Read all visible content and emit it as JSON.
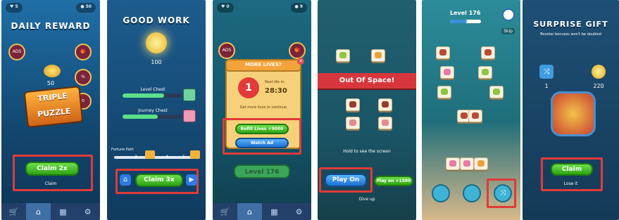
{
  "panels": [
    {
      "title": "DAILY REWARD",
      "coin_count": "50",
      "game_logo": "TRIPLE PUZZLE",
      "claim_button": "Claim 2x",
      "claim_label": "Claim",
      "side_icons_left": [
        "ADS"
      ],
      "nav": [
        "cart-icon",
        "home-icon",
        "grid-icon",
        "gear-icon"
      ]
    },
    {
      "title": "GOOD WORK",
      "coin_count": "100",
      "level_chest": "Level Chest",
      "journey_chest": "Journey Chest",
      "fortune_label": "Fortune Path",
      "path_steps": [
        "2",
        "4",
        "5"
      ],
      "claim_button": "Claim 3x"
    },
    {
      "title": "MORE LIVES?",
      "next_life_label": "Next life in:",
      "timer": "28:30",
      "lives_value": "1",
      "tagline": "Get more lives to continue",
      "refill_button": "Refill Lives +9000",
      "watch_button": "Watch Ad",
      "level_label": "Level 176",
      "side_icons_left": [
        "ADS"
      ]
    },
    {
      "banner": "Out Of Space!",
      "hint": "Hold to see the screen",
      "play_on_button": "Play On",
      "play_on_coins_button": "Play on +1500",
      "give_up": "Give up"
    },
    {
      "level_label": "Level 176",
      "skip_label": "Skip"
    },
    {
      "title": "SURPRISE GIFT",
      "subtitle": "Booster bonuses won't be doubled",
      "booster_count": "1",
      "coin_count": "220",
      "claim_button": "Claim",
      "lose_label": "Lose it"
    }
  ],
  "colors": {
    "highlight_box": "#e23a3a",
    "green_button": "#2fa316",
    "blue_button": "#1e6fd0"
  }
}
